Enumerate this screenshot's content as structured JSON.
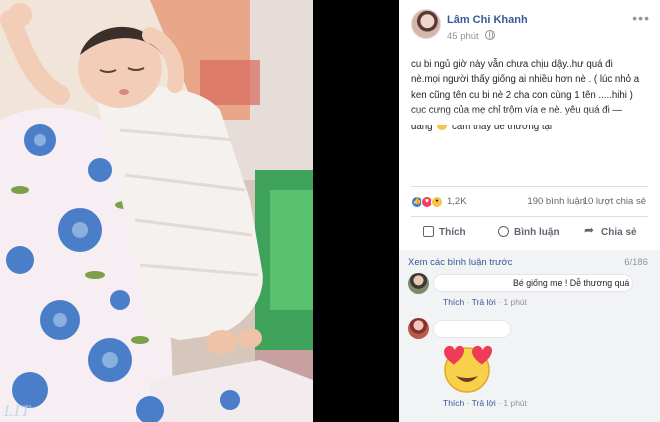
{
  "photo": {
    "watermark": "LIT"
  },
  "post": {
    "author": "Lâm Chi Khanh",
    "time": "45 phút",
    "more_icon": "ellipsis-icon",
    "privacy_icon": "globe-icon",
    "lines": [
      "cu bi ngủ giờ này vẫn chưa chịu dậy..hư quá đi",
      "nè.mọi người thấy giống ai nhiều hơn nè . ( lúc nhỏ a",
      "ken cũng tên cu bi nè 2 cha con cùng 1 tên .....hihi )",
      "cục cưng của mẹ chỉ trộm vía e nè. yêu quá đi —"
    ],
    "feeling_prefix": "đang",
    "feeling_text": "cảm thấy dễ thương tại",
    "reactions": {
      "count": "1,2K",
      "comments": "190 bình luận",
      "shares": "10 lượt chia sẻ",
      "colors": {
        "like": "#2f79f0",
        "love": "#ef3f5d",
        "wow": "#f6c344"
      }
    },
    "actions": {
      "like": "Thích",
      "comment": "Bình luận",
      "share": "Chia sẻ"
    }
  },
  "comments": {
    "view_previous": "Xem các bình luận trước",
    "counter": "6/186",
    "items": [
      {
        "text": "Bé giống me ! Dễ thương quá",
        "like": "Thích",
        "reply": "Trả lời",
        "time": "1 phút"
      },
      {
        "text": "",
        "sticker": "heart-eyes-emoji",
        "like": "Thích",
        "reply": "Trả lời",
        "time": "1 phút"
      }
    ]
  },
  "theme": {
    "link_color": "#385898",
    "muted_color": "#90949c",
    "text_color": "#1d2129"
  }
}
